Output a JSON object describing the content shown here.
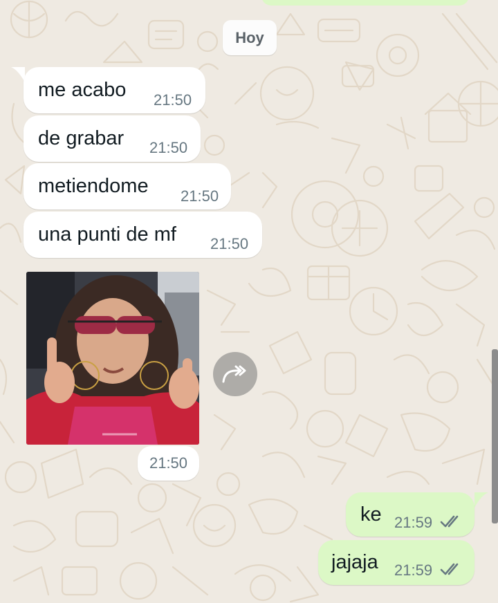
{
  "date_divider": "Hoy",
  "messages_in": [
    {
      "text": "me acabo",
      "time": "21:50"
    },
    {
      "text": "de grabar",
      "time": "21:50"
    },
    {
      "text": "metiendome",
      "time": "21:50"
    },
    {
      "text": "una punti de mf",
      "time": "21:50"
    }
  ],
  "photo_message": {
    "time": "21:50"
  },
  "messages_out": [
    {
      "text": "ke",
      "time": "21:59",
      "status": "read"
    },
    {
      "text": "jajaja",
      "time": "21:59",
      "status": "read"
    }
  ],
  "icons": {
    "forward": "forward-icon",
    "read_receipt": "double-check-icon"
  },
  "colors": {
    "background": "#efeae2",
    "incoming": "#ffffff",
    "outgoing": "#dcf8c6",
    "timestamp": "#667781",
    "read_ticks": "#667781"
  }
}
